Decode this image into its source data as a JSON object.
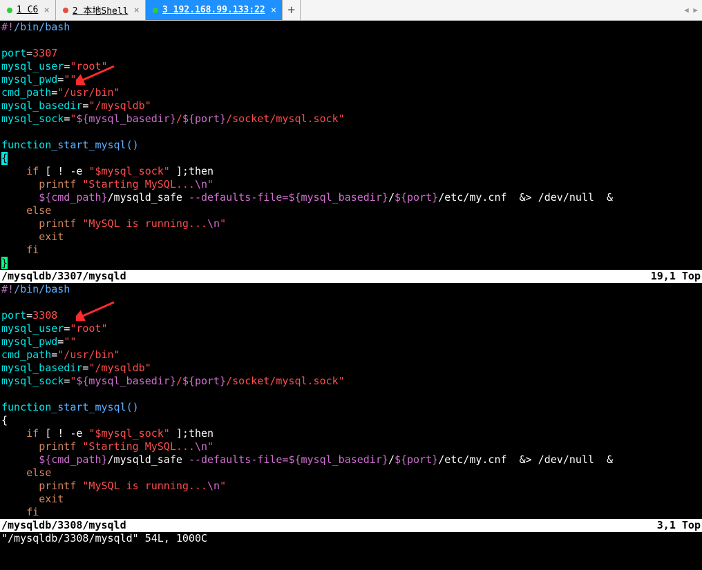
{
  "tabs": [
    {
      "dot": "green",
      "label": "1 C6"
    },
    {
      "dot": "red",
      "label": "2 本地Shell"
    },
    {
      "dot": "green",
      "label": "3 192.168.99.133:22",
      "active": true
    }
  ],
  "add_tab_glyph": "+",
  "nav_glyph": "◀ ▶",
  "pane1": {
    "code_tokens": {
      "shebang_l": "#!",
      "shebang_r": "/bin/bash",
      "port_kw": "port",
      "eq": "=",
      "port_val": "3307",
      "mu_kw": "mysql_user",
      "mu_val": "\"root\"",
      "mp_kw": "mysql_pwd",
      "mp_val": "\"\"",
      "cp_kw": "cmd_path",
      "cp_val": "\"/usr/bin\"",
      "mb_kw": "mysql_basedir",
      "mb_val": "\"/mysqldb\"",
      "ms_kw": "mysql_sock",
      "ms_q": "\"",
      "ms_v1": "${mysql_basedir}",
      "ms_sl1": "/",
      "ms_v2": "${port}",
      "ms_tail": "/socket/mysql.sock",
      "fn_kw": "function",
      "fn_name": "_start_mysql()",
      "if_kw": "if",
      "if_rest": " [ ! -e ",
      "if_sock": "\"$mysql_sock\"",
      "if_then": " ];then",
      "printf1": "printf",
      "printf1_str": "\"Starting MySQL...",
      "printf1_nl": "\\n",
      "printf1_end": "\"",
      "cmdpath_var": "${cmd_path}",
      "safe": "/mysqld_safe ",
      "flag": "--defaults-file=",
      "mb_var": "${mysql_basedir}",
      "slash2": "/",
      "port_var": "${port}",
      "cnf": "/etc/my.cnf  ",
      "amp": "&>",
      "devnull": " /dev/null  ",
      "bgamp": "&",
      "else_kw": "else",
      "printf2": "printf",
      "printf2_str": "\"MySQL is running...",
      "printf2_nl": "\\n",
      "printf2_end": "\"",
      "exit_kw": "exit",
      "fi_kw": "fi",
      "close_brace": "}"
    },
    "status_left": "/mysqldb/3307/mysqld",
    "status_pos": "19,1",
    "status_scroll": "Top"
  },
  "pane2": {
    "port_val": "3308",
    "status_left": "/mysqldb/3308/mysqld",
    "status_pos": "3,1",
    "status_scroll": "Top"
  },
  "cmdline": "\"/mysqldb/3308/mysqld\" 54L, 1000C"
}
